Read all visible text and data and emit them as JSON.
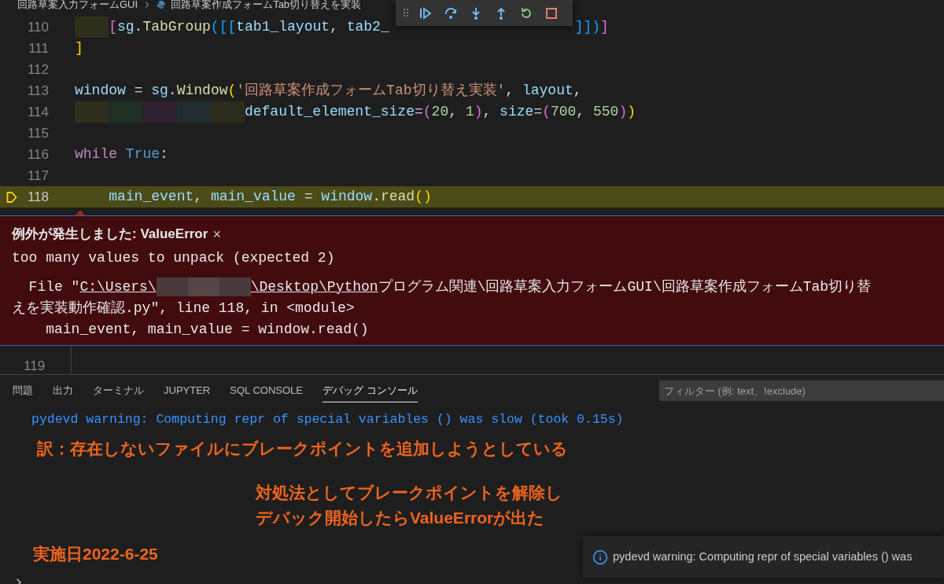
{
  "breadcrumb": [
    {
      "text": "回路草案入力フォームGUI",
      "kind": "folder"
    },
    {
      "text": "回路草案作成フォームTab切り替えを実装",
      "kind": "python-file"
    }
  ],
  "editor": {
    "lines": [
      {
        "number": "110",
        "current": false,
        "tokens": [
          {
            "text": "    [",
            "kind": "b2"
          },
          {
            "text": "sg",
            "kind": "var"
          },
          {
            "text": ".TabGroup",
            "kind": "fn"
          },
          {
            "text": "([[",
            "kind": "b3"
          },
          {
            "text": "tab1_layout",
            "kind": "var"
          },
          {
            "text": ",",
            "kind": "op"
          },
          {
            "text": "tab2_",
            "kind": "var"
          }
        ],
        "tail": [
          {
            "text": "]])",
            "kind": "b3"
          },
          {
            "text": "]",
            "kind": "b2"
          }
        ]
      },
      {
        "number": "111",
        "current": false,
        "tokens": [
          {
            "text": "]",
            "kind": "b1"
          }
        ]
      },
      {
        "number": "112",
        "current": false
      },
      {
        "number": "113",
        "current": false,
        "tokens": [
          {
            "text": "window",
            "kind": "var"
          },
          {
            "text": "=",
            "kind": "op"
          },
          {
            "text": "sg",
            "kind": "var"
          },
          {
            "text": ".",
            "kind": "op"
          },
          {
            "text": "Window",
            "kind": "fn"
          },
          {
            "text": "(",
            "kind": "b1"
          },
          {
            "text": "'回路草案作成フォームTab切り替え実装'",
            "kind": "str"
          },
          {
            "text": ",",
            "kind": "op"
          },
          {
            "text": "layout",
            "kind": "var"
          },
          {
            "text": ",",
            "kind": "op"
          }
        ]
      },
      {
        "number": "114",
        "current": false,
        "tokens": [
          {
            "text": "                    default_element_size",
            "kind": "var"
          },
          {
            "text": "=",
            "kind": "op"
          },
          {
            "text": "(",
            "kind": "b2"
          },
          {
            "text": "20",
            "kind": "num"
          },
          {
            "text": ",",
            "kind": "op"
          },
          {
            "text": "1",
            "kind": "num"
          },
          {
            "text": ")",
            "kind": "b2"
          },
          {
            "text": ",",
            "kind": "op"
          },
          {
            "text": "size",
            "kind": "var"
          },
          {
            "text": "=",
            "kind": "op"
          },
          {
            "text": "(",
            "kind": "b2"
          },
          {
            "text": "700",
            "kind": "num"
          },
          {
            "text": ",",
            "kind": "op"
          },
          {
            "text": "550",
            "kind": "num"
          },
          {
            "text": ")",
            "kind": "b2"
          },
          {
            "text": ")",
            "kind": "b1"
          }
        ]
      },
      {
        "number": "115",
        "current": false
      },
      {
        "number": "116",
        "current": false,
        "tokens": [
          {
            "text": "while",
            "kind": "kw"
          },
          {
            "text": "True",
            "kind": "const"
          },
          {
            "text": ":",
            "kind": "op"
          }
        ]
      },
      {
        "number": "117",
        "current": false
      },
      {
        "number": "118",
        "current": true,
        "tokens": [
          {
            "text": "    main_event",
            "kind": "var"
          },
          {
            "text": ",",
            "kind": "op"
          },
          {
            "text": "main_value",
            "kind": "var"
          },
          {
            "text": "=",
            "kind": "op"
          },
          {
            "text": "window",
            "kind": "var"
          },
          {
            "text": ".",
            "kind": "op"
          },
          {
            "text": "read",
            "kind": "fn"
          },
          {
            "text": "()",
            "kind": "b1"
          }
        ]
      }
    ],
    "after_widget_line": "119"
  },
  "exception": {
    "title": "例外が発生しました: ValueError",
    "close": "×",
    "message": "too many values to unpack (expected 2)",
    "traceback": [
      [
        {
          "text": "  File \"",
          "kind": "plain"
        },
        {
          "text": "C:\\Users\\",
          "kind": "link"
        },
        {
          "kind": "redacted"
        },
        {
          "text": "\\Desktop\\Python",
          "kind": "link"
        },
        {
          "text": "プログラム関連\\回路草案入力フォームGUI\\回路草案作成フォームTab切り替",
          "kind": "plain"
        }
      ],
      [
        {
          "text": "えを実装動作確認.py\", line 118, in <module>",
          "kind": "plain"
        }
      ],
      [
        {
          "text": "    main_event, main_value = window.read()",
          "kind": "plain"
        }
      ]
    ]
  },
  "panel": {
    "tabs": [
      {
        "label": "問題",
        "selected": false
      },
      {
        "label": "出力",
        "selected": false
      },
      {
        "label": "ターミナル",
        "selected": false
      },
      {
        "label": "JUPYTER",
        "selected": false
      },
      {
        "label": "SQL CONSOLE",
        "selected": false
      },
      {
        "label": "デバッグ コンソール",
        "selected": true
      }
    ],
    "filter": {
      "placeholder": "フィルター (例: text、!exclude)"
    },
    "console": [
      "pydevd warning: Computing repr of special variables () was slow (took 0.15s)"
    ]
  },
  "annotations": [
    {
      "lines": [
        "訳：存在しないファイルにブレークポイントを追加しようとしている"
      ],
      "kind": "left"
    },
    {
      "lines": [
        "対処法としてブレークポイントを解除し",
        "デバック開始したらValueErrorが出た"
      ],
      "kind": "center"
    },
    {
      "lines": [
        "実施日2022-6-25"
      ],
      "kind": "date"
    }
  ],
  "notification": {
    "message": "pydevd warning: Computing repr of special variables () was"
  }
}
